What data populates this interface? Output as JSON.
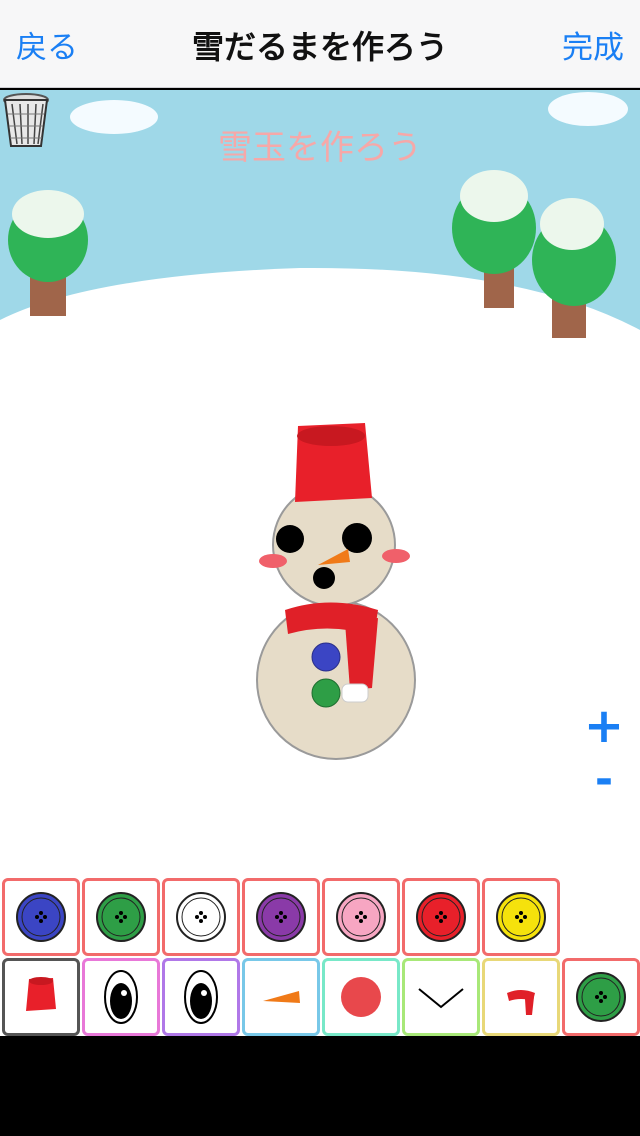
{
  "nav": {
    "back_label": "戻る",
    "title": "雪だるまを作ろう",
    "done_label": "完成"
  },
  "scene": {
    "hint": "雪玉を作ろう"
  },
  "controls": {
    "plus_label": "+",
    "minus_label": "-"
  },
  "colors": {
    "accent": "#1a7ff4",
    "sky": "#9fd8e8",
    "tray_border": "#f26b6b"
  },
  "button_palette": [
    {
      "name": "blue-button",
      "color": "#3b45c4"
    },
    {
      "name": "green-button",
      "color": "#2e9e46"
    },
    {
      "name": "white-button",
      "color": "#ffffff"
    },
    {
      "name": "purple-button",
      "color": "#8a3aa8"
    },
    {
      "name": "pink-button",
      "color": "#f7a6c2"
    },
    {
      "name": "red-button",
      "color": "#e8202a"
    },
    {
      "name": "yellow-button",
      "color": "#f5e20c"
    }
  ],
  "part_categories": [
    {
      "name": "hat",
      "border": "#555555"
    },
    {
      "name": "eye-left",
      "border": "#e878d8"
    },
    {
      "name": "eye-right",
      "border": "#b078e8"
    },
    {
      "name": "nose",
      "border": "#78c8e8"
    },
    {
      "name": "cheek",
      "border": "#78e8c8"
    },
    {
      "name": "mouth",
      "border": "#a8e878"
    },
    {
      "name": "scarf",
      "border": "#e8d878"
    },
    {
      "name": "button",
      "border": "#f26b6b"
    }
  ]
}
